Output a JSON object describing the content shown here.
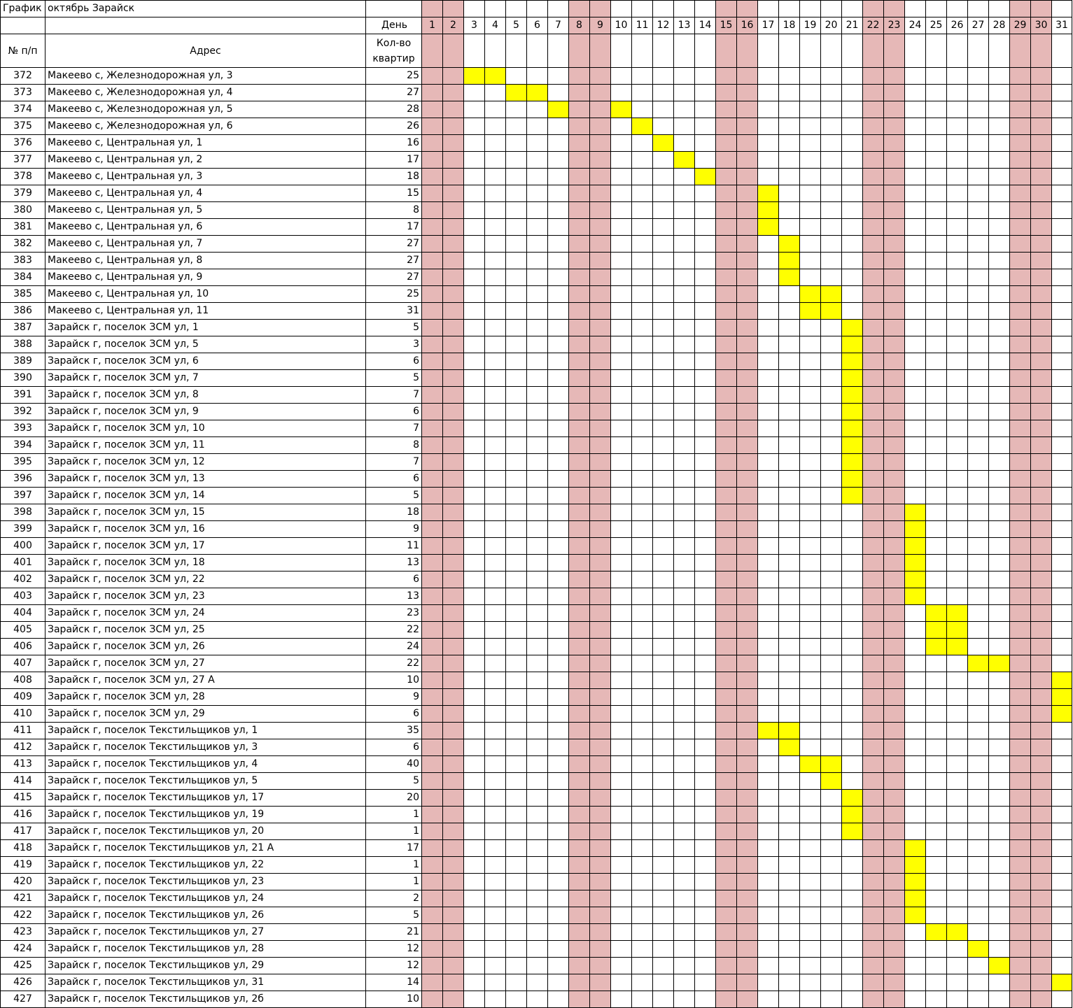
{
  "header": {
    "title_left": "График",
    "title_right": "октябрь Зарайск",
    "day_label": "День",
    "col_num": "№ п/п",
    "col_addr": "Адрес",
    "col_qty": "Кол-во квартир"
  },
  "days": [
    1,
    2,
    3,
    4,
    5,
    6,
    7,
    8,
    9,
    10,
    11,
    12,
    13,
    14,
    15,
    16,
    17,
    18,
    19,
    20,
    21,
    22,
    23,
    24,
    25,
    26,
    27,
    28,
    29,
    30,
    31
  ],
  "weekend_days": [
    1,
    2,
    8,
    9,
    15,
    16,
    22,
    23,
    29,
    30
  ],
  "colors": {
    "weekend": "#e6b8b7",
    "scheduled": "#ffff00"
  },
  "rows": [
    {
      "n": "372",
      "addr": "Макеево с, Железнодорожная ул, 3",
      "qty": "25",
      "days": [
        3,
        4
      ]
    },
    {
      "n": "373",
      "addr": "Макеево с, Железнодорожная ул, 4",
      "qty": "27",
      "days": [
        5,
        6
      ]
    },
    {
      "n": "374",
      "addr": "Макеево с, Железнодорожная ул, 5",
      "qty": "28",
      "days": [
        7,
        10
      ]
    },
    {
      "n": "375",
      "addr": "Макеево с, Железнодорожная ул, 6",
      "qty": "26",
      "days": [
        11
      ]
    },
    {
      "n": "376",
      "addr": "Макеево с, Центральная ул, 1",
      "qty": "16",
      "days": [
        12
      ]
    },
    {
      "n": "377",
      "addr": "Макеево с, Центральная ул, 2",
      "qty": "17",
      "days": [
        13
      ]
    },
    {
      "n": "378",
      "addr": "Макеево с, Центральная ул, 3",
      "qty": "18",
      "days": [
        14
      ]
    },
    {
      "n": "379",
      "addr": "Макеево с, Центральная ул, 4",
      "qty": "15",
      "days": [
        17
      ]
    },
    {
      "n": "380",
      "addr": "Макеево с, Центральная ул, 5",
      "qty": "8",
      "days": [
        17
      ]
    },
    {
      "n": "381",
      "addr": "Макеево с, Центральная ул, 6",
      "qty": "17",
      "days": [
        17
      ]
    },
    {
      "n": "382",
      "addr": "Макеево с, Центральная ул, 7",
      "qty": "27",
      "days": [
        18
      ]
    },
    {
      "n": "383",
      "addr": "Макеево с, Центральная ул, 8",
      "qty": "27",
      "days": [
        18
      ]
    },
    {
      "n": "384",
      "addr": "Макеево с, Центральная ул, 9",
      "qty": "27",
      "days": [
        18
      ]
    },
    {
      "n": "385",
      "addr": "Макеево с, Центральная ул, 10",
      "qty": "25",
      "days": [
        19,
        20
      ]
    },
    {
      "n": "386",
      "addr": "Макеево с, Центральная ул, 11",
      "qty": "31",
      "days": [
        19,
        20
      ]
    },
    {
      "n": "387",
      "addr": "Зарайск г, поселок ЗСМ ул, 1",
      "qty": "5",
      "days": [
        21
      ]
    },
    {
      "n": "388",
      "addr": "Зарайск г, поселок ЗСМ ул, 5",
      "qty": "3",
      "days": [
        21
      ]
    },
    {
      "n": "389",
      "addr": "Зарайск г, поселок ЗСМ ул, 6",
      "qty": "6",
      "days": [
        21
      ]
    },
    {
      "n": "390",
      "addr": "Зарайск г, поселок ЗСМ ул, 7",
      "qty": "5",
      "days": [
        21
      ]
    },
    {
      "n": "391",
      "addr": "Зарайск г, поселок ЗСМ ул, 8",
      "qty": "7",
      "days": [
        21
      ]
    },
    {
      "n": "392",
      "addr": "Зарайск г, поселок ЗСМ ул, 9",
      "qty": "6",
      "days": [
        21
      ]
    },
    {
      "n": "393",
      "addr": "Зарайск г, поселок ЗСМ ул, 10",
      "qty": "7",
      "days": [
        21
      ]
    },
    {
      "n": "394",
      "addr": "Зарайск г, поселок ЗСМ ул, 11",
      "qty": "8",
      "days": [
        21
      ]
    },
    {
      "n": "395",
      "addr": "Зарайск г, поселок ЗСМ ул, 12",
      "qty": "7",
      "days": [
        21
      ]
    },
    {
      "n": "396",
      "addr": "Зарайск г, поселок ЗСМ ул, 13",
      "qty": "6",
      "days": [
        21
      ]
    },
    {
      "n": "397",
      "addr": "Зарайск г, поселок ЗСМ ул, 14",
      "qty": "5",
      "days": [
        21
      ]
    },
    {
      "n": "398",
      "addr": "Зарайск г, поселок ЗСМ ул, 15",
      "qty": "18",
      "days": [
        24
      ]
    },
    {
      "n": "399",
      "addr": "Зарайск г, поселок ЗСМ ул, 16",
      "qty": "9",
      "days": [
        24
      ]
    },
    {
      "n": "400",
      "addr": "Зарайск г, поселок ЗСМ ул, 17",
      "qty": "11",
      "days": [
        24
      ]
    },
    {
      "n": "401",
      "addr": "Зарайск г, поселок ЗСМ ул, 18",
      "qty": "13",
      "days": [
        24
      ]
    },
    {
      "n": "402",
      "addr": "Зарайск г, поселок ЗСМ ул, 22",
      "qty": "6",
      "days": [
        24
      ]
    },
    {
      "n": "403",
      "addr": "Зарайск г, поселок ЗСМ ул, 23",
      "qty": "13",
      "days": [
        24
      ]
    },
    {
      "n": "404",
      "addr": "Зарайск г, поселок ЗСМ ул, 24",
      "qty": "23",
      "days": [
        25,
        26
      ]
    },
    {
      "n": "405",
      "addr": "Зарайск г, поселок ЗСМ ул, 25",
      "qty": "22",
      "days": [
        25,
        26
      ]
    },
    {
      "n": "406",
      "addr": "Зарайск г, поселок ЗСМ ул, 26",
      "qty": "24",
      "days": [
        25,
        26
      ]
    },
    {
      "n": "407",
      "addr": "Зарайск г, поселок ЗСМ ул, 27",
      "qty": "22",
      "days": [
        27,
        28
      ]
    },
    {
      "n": "408",
      "addr": "Зарайск г, поселок ЗСМ ул, 27 А",
      "qty": "10",
      "days": [
        31
      ]
    },
    {
      "n": "409",
      "addr": "Зарайск г, поселок ЗСМ ул, 28",
      "qty": "9",
      "days": [
        31
      ]
    },
    {
      "n": "410",
      "addr": "Зарайск г, поселок ЗСМ ул, 29",
      "qty": "6",
      "days": [
        31
      ]
    },
    {
      "n": "411",
      "addr": "Зарайск г, поселок Текстильщиков ул, 1",
      "qty": "35",
      "days": [
        17,
        18
      ]
    },
    {
      "n": "412",
      "addr": "Зарайск г, поселок Текстильщиков ул, 3",
      "qty": "6",
      "days": [
        18
      ]
    },
    {
      "n": "413",
      "addr": "Зарайск г, поселок Текстильщиков ул, 4",
      "qty": "40",
      "days": [
        19,
        20
      ]
    },
    {
      "n": "414",
      "addr": "Зарайск г, поселок Текстильщиков ул, 5",
      "qty": "5",
      "days": [
        20
      ]
    },
    {
      "n": "415",
      "addr": "Зарайск г, поселок Текстильщиков ул, 17",
      "qty": "20",
      "days": [
        21
      ]
    },
    {
      "n": "416",
      "addr": "Зарайск г, поселок Текстильщиков ул, 19",
      "qty": "1",
      "days": [
        21
      ]
    },
    {
      "n": "417",
      "addr": "Зарайск г, поселок Текстильщиков ул, 20",
      "qty": "1",
      "days": [
        21
      ]
    },
    {
      "n": "418",
      "addr": "Зарайск г, поселок Текстильщиков ул, 21 А",
      "qty": "17",
      "days": [
        24
      ]
    },
    {
      "n": "419",
      "addr": "Зарайск г, поселок Текстильщиков ул, 22",
      "qty": "1",
      "days": [
        24
      ]
    },
    {
      "n": "420",
      "addr": "Зарайск г, поселок Текстильщиков ул, 23",
      "qty": "1",
      "days": [
        24
      ]
    },
    {
      "n": "421",
      "addr": "Зарайск г, поселок Текстильщиков ул, 24",
      "qty": "2",
      "days": [
        24
      ]
    },
    {
      "n": "422",
      "addr": "Зарайск г, поселок Текстильщиков ул, 26",
      "qty": "5",
      "days": [
        24
      ]
    },
    {
      "n": "423",
      "addr": "Зарайск г, поселок Текстильщиков ул, 27",
      "qty": "21",
      "days": [
        25,
        26
      ]
    },
    {
      "n": "424",
      "addr": "Зарайск г, поселок Текстильщиков ул, 28",
      "qty": "12",
      "days": [
        27
      ]
    },
    {
      "n": "425",
      "addr": "Зарайск г, поселок Текстильщиков ул, 29",
      "qty": "12",
      "days": [
        28
      ]
    },
    {
      "n": "426",
      "addr": "Зарайск г, поселок Текстильщиков ул, 31",
      "qty": "14",
      "days": [
        31
      ]
    },
    {
      "n": "427",
      "addr": "Зарайск г, поселок Текстильщиков ул, 2б",
      "qty": "10",
      "days": []
    }
  ]
}
